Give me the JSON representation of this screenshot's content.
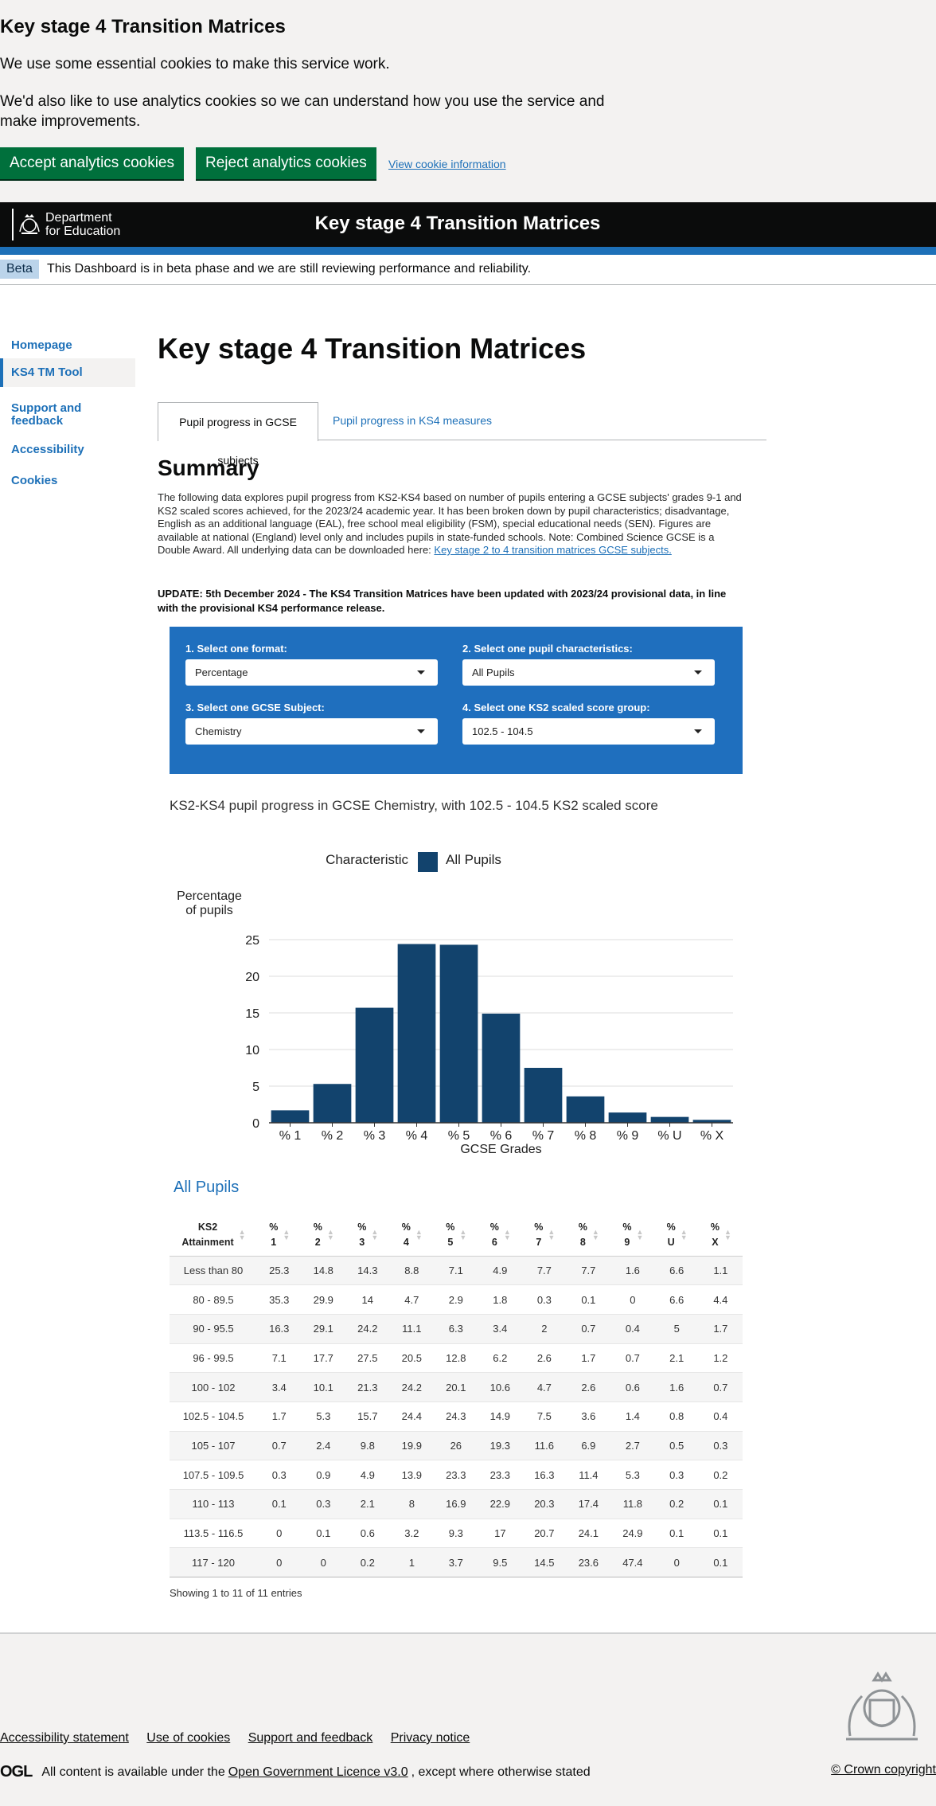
{
  "cookie": {
    "title": "Key stage 4 Transition Matrices",
    "p1": "We use some essential cookies to make this service work.",
    "p2": "We'd also like to use analytics cookies so we can understand how you use the service and make improvements.",
    "accept": "Accept analytics cookies",
    "reject": "Reject analytics cookies",
    "info_link": "View cookie information"
  },
  "header": {
    "dept_line1": "Department",
    "dept_line2": "for Education",
    "title": "Key stage 4 Transition Matrices"
  },
  "beta": {
    "tag": "Beta",
    "message": "This Dashboard is in beta phase and we are still reviewing performance and reliability."
  },
  "sidebar": {
    "items": [
      {
        "label": "Homepage"
      },
      {
        "label": "KS4 TM Tool"
      },
      {
        "label": "Support and feedback"
      },
      {
        "label": "Accessibility"
      },
      {
        "label": "Cookies"
      }
    ]
  },
  "main": {
    "title": "Key stage 4 Transition Matrices",
    "tabs": [
      {
        "label": "Pupil progress in GCSE subjects"
      },
      {
        "label": "Pupil progress in KS4 measures"
      }
    ],
    "summary_heading": "Summary",
    "summary_text": "The following data explores pupil progress from KS2-KS4 based on number of pupils entering a GCSE subjects' grades 9-1 and KS2 scaled scores achieved, for the 2023/24 academic year. It has been broken down by pupil characteristics; disadvantage, English as an additional language (EAL), free school meal eligibility (FSM), special educational needs (SEN). Figures are available at national (England) level only and includes pupils in state-funded schools. Note: Combined Science GCSE is a Double Award. All underlying data can be downloaded here:",
    "summary_link": "Key stage 2 to 4 transition matrices GCSE subjects.",
    "update": "UPDATE: 5th December 2024 - The KS4 Transition Matrices have been updated with 2023/24 provisional data, in line with the provisional KS4 performance release."
  },
  "selectors": {
    "format": {
      "label": "1. Select one format:",
      "value": "Percentage"
    },
    "characteristic": {
      "label": "2. Select one pupil characteristics:",
      "value": "All Pupils"
    },
    "subject": {
      "label": "3. Select one GCSE Subject:",
      "value": "Chemistry"
    },
    "ks2": {
      "label": "4. Select one KS2 scaled score group:",
      "value": "102.5 - 104.5"
    }
  },
  "chart_heading": "KS2-KS4 pupil progress in GCSE Chemistry, with 102.5 - 104.5 KS2 scaled score",
  "chart_data": {
    "type": "bar",
    "legend_title": "Characteristic",
    "categories": [
      "% 1",
      "% 2",
      "% 3",
      "% 4",
      "% 5",
      "% 6",
      "% 7",
      "% 8",
      "% 9",
      "% U",
      "% X"
    ],
    "series": [
      {
        "name": "All Pupils",
        "color": "#12436d",
        "values": [
          1.7,
          5.3,
          15.7,
          24.4,
          24.3,
          14.9,
          7.5,
          3.6,
          1.4,
          0.8,
          0.4
        ]
      }
    ],
    "xlabel": "GCSE Grades",
    "ylabel": [
      "Percentage",
      "of pupils"
    ],
    "ylim": [
      0,
      25
    ],
    "yticks": [
      "0",
      "5",
      "10",
      "15",
      "20",
      "25"
    ],
    "grid": true,
    "legend_position": "top"
  },
  "table": {
    "title": "All Pupils",
    "headers": [
      [
        "KS2",
        "Attainment"
      ],
      [
        "%",
        "1"
      ],
      [
        "%",
        "2"
      ],
      [
        "%",
        "3"
      ],
      [
        "%",
        "4"
      ],
      [
        "%",
        "5"
      ],
      [
        "%",
        "6"
      ],
      [
        "%",
        "7"
      ],
      [
        "%",
        "8"
      ],
      [
        "%",
        "9"
      ],
      [
        "%",
        "U"
      ],
      [
        "%",
        "X"
      ]
    ],
    "rows": [
      [
        "Less than 80",
        "25.3",
        "14.8",
        "14.3",
        "8.8",
        "7.1",
        "4.9",
        "7.7",
        "7.7",
        "1.6",
        "6.6",
        "1.1"
      ],
      [
        "80 - 89.5",
        "35.3",
        "29.9",
        "14",
        "4.7",
        "2.9",
        "1.8",
        "0.3",
        "0.1",
        "0",
        "6.6",
        "4.4"
      ],
      [
        "90 - 95.5",
        "16.3",
        "29.1",
        "24.2",
        "11.1",
        "6.3",
        "3.4",
        "2",
        "0.7",
        "0.4",
        "5",
        "1.7"
      ],
      [
        "96 - 99.5",
        "7.1",
        "17.7",
        "27.5",
        "20.5",
        "12.8",
        "6.2",
        "2.6",
        "1.7",
        "0.7",
        "2.1",
        "1.2"
      ],
      [
        "100 - 102",
        "3.4",
        "10.1",
        "21.3",
        "24.2",
        "20.1",
        "10.6",
        "4.7",
        "2.6",
        "0.6",
        "1.6",
        "0.7"
      ],
      [
        "102.5 - 104.5",
        "1.7",
        "5.3",
        "15.7",
        "24.4",
        "24.3",
        "14.9",
        "7.5",
        "3.6",
        "1.4",
        "0.8",
        "0.4"
      ],
      [
        "105 - 107",
        "0.7",
        "2.4",
        "9.8",
        "19.9",
        "26",
        "19.3",
        "11.6",
        "6.9",
        "2.7",
        "0.5",
        "0.3"
      ],
      [
        "107.5 - 109.5",
        "0.3",
        "0.9",
        "4.9",
        "13.9",
        "23.3",
        "23.3",
        "16.3",
        "11.4",
        "5.3",
        "0.3",
        "0.2"
      ],
      [
        "110 - 113",
        "0.1",
        "0.3",
        "2.1",
        "8",
        "16.9",
        "22.9",
        "20.3",
        "17.4",
        "11.8",
        "0.2",
        "0.1"
      ],
      [
        "113.5 - 116.5",
        "0",
        "0.1",
        "0.6",
        "3.2",
        "9.3",
        "17",
        "20.7",
        "24.1",
        "24.9",
        "0.1",
        "0.1"
      ],
      [
        "117 - 120",
        "0",
        "0",
        "0.2",
        "1",
        "3.7",
        "9.5",
        "14.5",
        "23.6",
        "47.4",
        "0",
        "0.1"
      ]
    ],
    "info": "Showing 1 to 11 of 11 entries"
  },
  "footer": {
    "links": [
      "Accessibility statement",
      "Use of cookies",
      "Support and feedback",
      "Privacy notice"
    ],
    "ogl": "OGL",
    "licence_pre": "All content is available under the",
    "licence_link": "Open Government Licence v3.0",
    "licence_post": ", except where otherwise stated",
    "copyright": "© Crown copyright"
  }
}
